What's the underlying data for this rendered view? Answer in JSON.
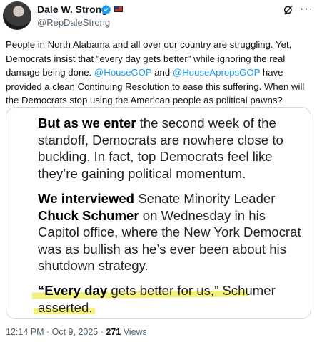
{
  "author": {
    "name": "Dale W. Strong",
    "handle": "@RepDaleStrong",
    "verified_icon": "verified-badge-icon",
    "flag_icon": "us-flag-icon"
  },
  "header_icons": {
    "grok": "grok-icon",
    "more": "more-icon"
  },
  "tweet": {
    "text_part1": "People in North Alabama and all over our country are struggling. Yet, Democrats insist that \"every day gets better\" while ignoring the real damage being done. ",
    "mention1": "@HouseGOP",
    "text_part2": " and ",
    "mention2": "@HouseApropsGOP",
    "text_part3": " have provided a clean Continuing Resolution to ease this suffering. When will the Democrats stop using the American people as political pawns?"
  },
  "image_card": {
    "p1_bold": "But as we enter",
    "p1_rest": " the second week of the standoff, Democrats are nowhere close to buckling. In fact, top Democrats feel like they’re gaining political momentum.",
    "p2_bold1": "We interviewed",
    "p2_mid": " Senate Minority Leader ",
    "p2_bold2": "Chuck Schumer",
    "p2_rest": " on Wednesday in his Capitol office, where the New York Democrat was as bullish as he’s ever been about his shutdown strategy.",
    "p3_bold": "“Every day",
    "p3_rest": " gets better for us,” Schumer asserted.",
    "highlight_color": "#f1ef6e"
  },
  "footer": {
    "time": "12:14 PM",
    "sep": " · ",
    "date": "Oct 9, 2025",
    "sep2": " · ",
    "views": "271",
    "views_label": " Views"
  }
}
